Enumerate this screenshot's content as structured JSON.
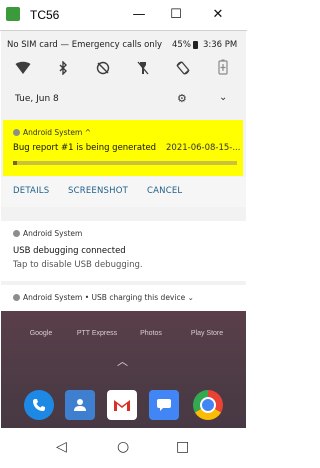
{
  "window": {
    "title": "TC56",
    "minimize": "—",
    "maximize": "☐",
    "close": "✕"
  },
  "status_bar": {
    "carrier": "No SIM card — Emergency calls only",
    "battery": "45%",
    "time": "3:36 PM"
  },
  "quick_settings": {
    "icons": [
      "wifi-icon",
      "bluetooth-icon",
      "do-not-disturb-off-icon",
      "flashlight-off-icon",
      "auto-rotate-icon",
      "battery-saver-icon"
    ],
    "date": "Tue, Jun 8"
  },
  "notifications": {
    "bug_report": {
      "app": "Android System",
      "expand": "^",
      "title": "Bug report #1 is being generated",
      "time": "2021-06-08-15-...",
      "progress": 0.02,
      "highlight_color": "#ffff00"
    },
    "actions": [
      "DETAILS",
      "SCREENSHOT",
      "CANCEL"
    ],
    "usb_debug": {
      "app": "Android System",
      "title": "USB debugging connected",
      "subtitle": "Tap to disable USB debugging."
    },
    "usb_charging": {
      "text": "Android System • USB charging this device ⌄"
    }
  },
  "home": {
    "labels": [
      "Google",
      "PTT Express",
      "Photos",
      "Play Store"
    ],
    "dock": [
      "phone-icon",
      "contacts-icon",
      "gmail-icon",
      "messages-icon",
      "chrome-icon"
    ]
  },
  "navbar": {
    "back": "◁",
    "home": "○",
    "recents": "□"
  }
}
